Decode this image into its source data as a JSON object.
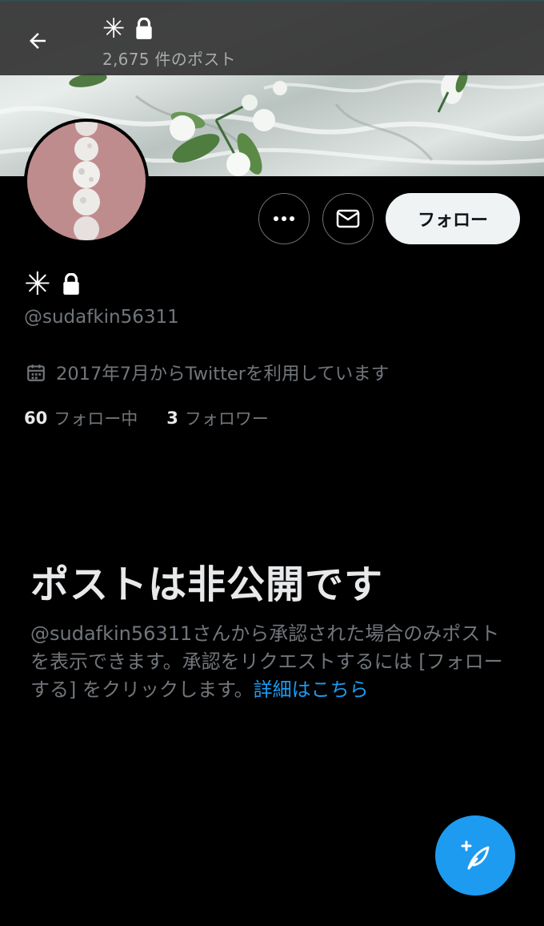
{
  "header": {
    "title_symbol": "✳",
    "post_count": "2,675 件のポスト"
  },
  "profile": {
    "display_name_symbol": "✳",
    "handle": "@sudafkin56311",
    "joined": "2017年7月からTwitterを利用しています",
    "following_count": "60",
    "following_label": "フォロー中",
    "followers_count": "3",
    "followers_label": "フォロワー"
  },
  "actions": {
    "follow_label": "フォロー"
  },
  "private_notice": {
    "title": "ポストは非公開です",
    "description": "@sudafkin56311さんから承認された場合のみポストを表示できます。承認をリクエストするには [フォローする] をクリックします。",
    "learn_more": "詳細はこちら"
  },
  "colors": {
    "accent": "#1d9bf0",
    "avatar_bg": "#bf8c8e",
    "background": "#000000"
  },
  "icons": [
    "back-arrow-icon",
    "lock-icon",
    "more-icon",
    "mail-icon",
    "calendar-icon",
    "compose-post-icon"
  ]
}
